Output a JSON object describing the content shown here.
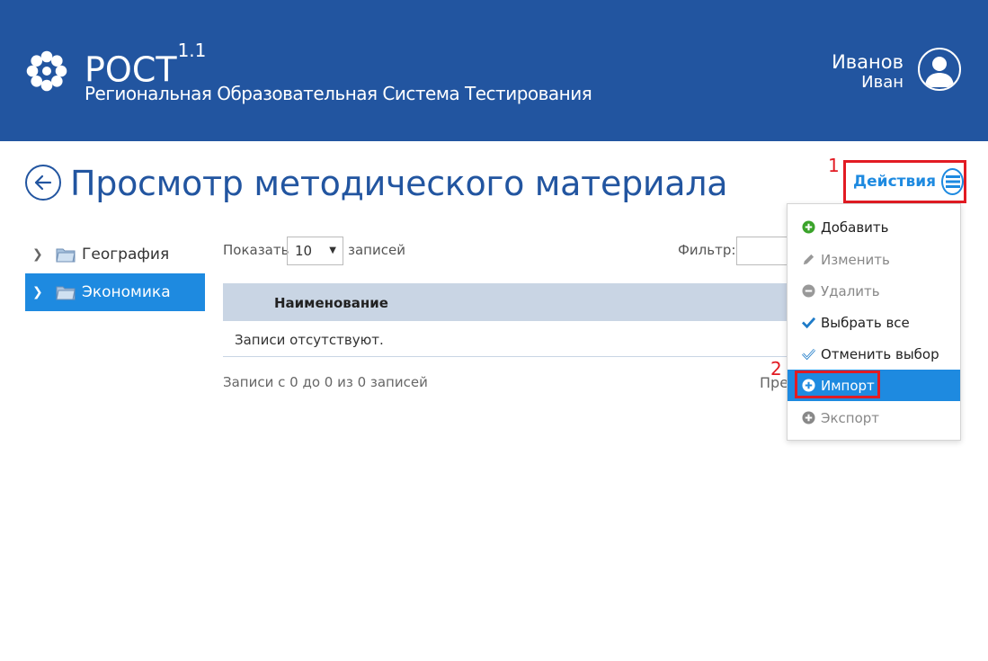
{
  "header": {
    "app_name": "РОСТ",
    "app_version": "1.1",
    "app_subtitle": "Региональная Образовательная Система Тестирования",
    "user_last_name": "Иванов",
    "user_first_name": "Иван"
  },
  "page": {
    "title": "Просмотр методического материала"
  },
  "actions": {
    "label": "Действия",
    "marker": "1",
    "import_marker": "2",
    "menu": [
      {
        "label": "Добавить",
        "icon": "plus-circle-icon",
        "state": "enabled",
        "icon_color": "#3aa32a"
      },
      {
        "label": "Изменить",
        "icon": "pencil-icon",
        "state": "disabled",
        "icon_color": "#999999"
      },
      {
        "label": "Удалить",
        "icon": "minus-circle-icon",
        "state": "disabled",
        "icon_color": "#999999"
      },
      {
        "label": "Выбрать все",
        "icon": "check-icon",
        "state": "enabled",
        "icon_color": "#1e7bc8"
      },
      {
        "label": "Отменить выбор",
        "icon": "check-outline-icon",
        "state": "enabled",
        "icon_color": "#1e7bc8"
      },
      {
        "label": "Импорт",
        "icon": "plus-circle-icon",
        "state": "active",
        "icon_color": "#ffffff"
      },
      {
        "label": "Экспорт",
        "icon": "plus-circle-icon",
        "state": "disabled",
        "icon_color": "#888888"
      }
    ]
  },
  "tree": {
    "items": [
      {
        "label": "География",
        "selected": false
      },
      {
        "label": "Экономика",
        "selected": true
      }
    ]
  },
  "table": {
    "show_label": "Показать",
    "page_size": "10",
    "records_label": "записей",
    "filter_label": "Фильтр:",
    "filter_value": "",
    "columns": [
      "Наименование"
    ],
    "empty_text": "Записи отсутствуют.",
    "paging_info": "Записи с 0 до 0 из 0 записей",
    "prev_label": "Предыдущая"
  },
  "colors": {
    "header_bg": "#2255a0",
    "accent": "#1e8ae0",
    "table_header": "#c9d5e4",
    "highlight_red": "#e21b23"
  }
}
